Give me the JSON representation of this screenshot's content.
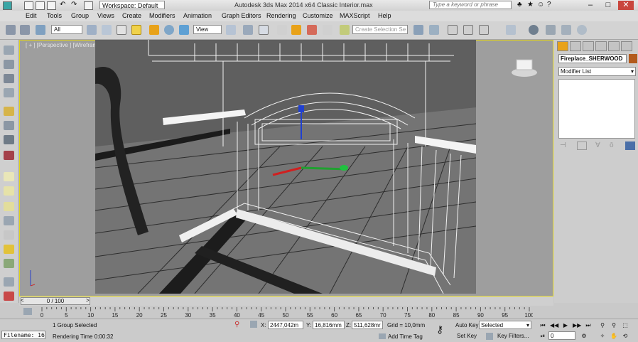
{
  "titlebar": {
    "workspace": "Workspace: Default",
    "app_title": "Autodesk 3ds Max  2014 x64     Classic Interior.max",
    "search_placeholder": "Type a keyword or phrase"
  },
  "menu": [
    "Edit",
    "Tools",
    "Group",
    "Views",
    "Create",
    "Modifiers",
    "Animation",
    "Graph Editors",
    "Rendering",
    "Customize",
    "MAXScript",
    "Help"
  ],
  "toolbar": {
    "filter": "All",
    "ref_coord": "View",
    "named_sel": "Create Selection Se"
  },
  "viewport": {
    "label": "[ + ] [Perspective ] [Wireframe ]"
  },
  "command_panel": {
    "object_name": "Fireplace_SHERWOOD",
    "object_color": "#b35a1d",
    "modifier_list": "Modifier List"
  },
  "timeline": {
    "slider": "0 / 100",
    "ticks": [
      "0",
      "5",
      "10",
      "15",
      "20",
      "25",
      "30",
      "35",
      "40",
      "45",
      "50",
      "55",
      "60",
      "65",
      "70",
      "75",
      "80",
      "85",
      "90",
      "95",
      "100"
    ]
  },
  "status": {
    "listener": "Filename: 16",
    "selection": "1 Group Selected",
    "render_time": "Rendering Time  0:00:32",
    "x_label": "X:",
    "x": "2447,042m",
    "y_label": "Y:",
    "y": "16,816mm",
    "z_label": "Z:",
    "z": "511,628mr",
    "grid": "Grid = 10,0mm",
    "add_time_tag": "Add Time Tag",
    "auto_key": "Auto Key",
    "set_key": "Set Key",
    "key_mode": "Selected",
    "key_filters": "Key Filters...",
    "frame": "0"
  },
  "colors": {
    "viewport_border": "#e0d31a",
    "accent_orange": "#e8a21a"
  }
}
